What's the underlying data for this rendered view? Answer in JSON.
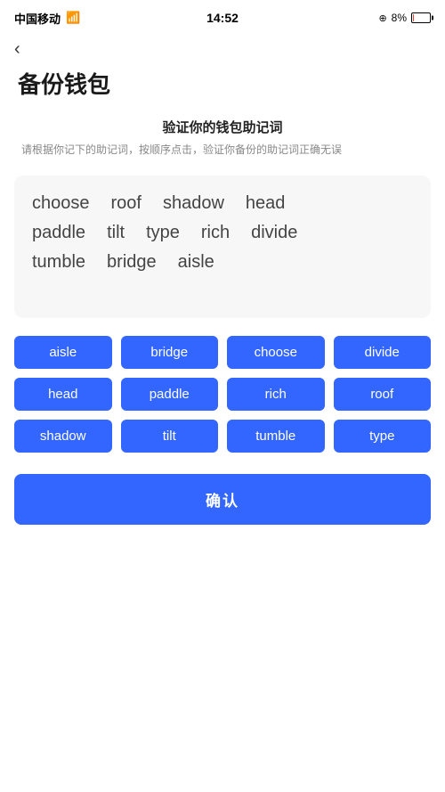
{
  "statusBar": {
    "carrier": "中国移动",
    "time": "14:52",
    "batteryPercent": "8%"
  },
  "header": {
    "backLabel": "‹",
    "title": "备份钱包"
  },
  "verifySection": {
    "heading": "验证你的钱包助记词",
    "description": "请根据你记下的助记词，按顺序点击，验证你备份的助记词正确无误"
  },
  "wordDisplay": {
    "rows": [
      [
        "choose",
        "roof",
        "shadow",
        "head"
      ],
      [
        "paddle",
        "tilt",
        "type",
        "rich",
        "divide"
      ],
      [
        "tumble",
        "bridge",
        "aisle"
      ]
    ]
  },
  "wordButtons": {
    "rows": [
      [
        "aisle",
        "bridge",
        "choose",
        "divide"
      ],
      [
        "head",
        "paddle",
        "rich",
        "roof"
      ],
      [
        "shadow",
        "tilt",
        "tumble",
        "type"
      ]
    ]
  },
  "confirmButton": {
    "label": "确认"
  }
}
